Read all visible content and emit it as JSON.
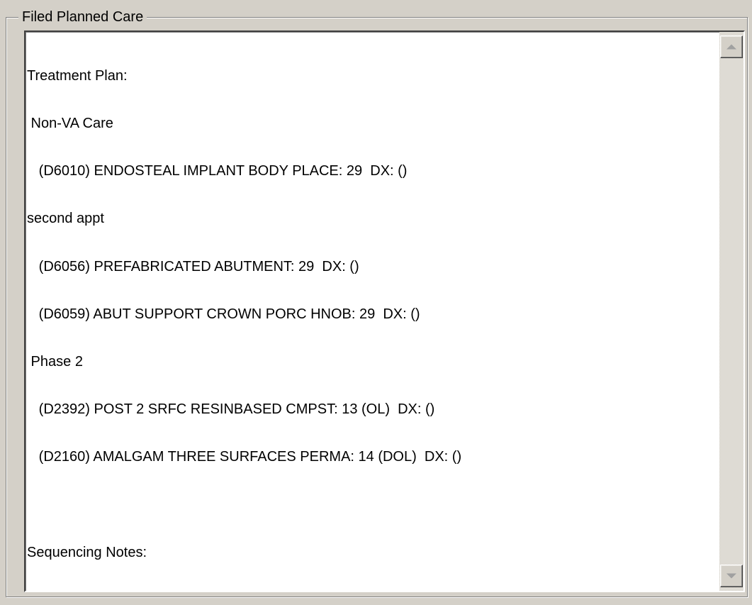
{
  "groupbox": {
    "title": "Filed Planned Care"
  },
  "memo": {
    "lines": [
      "Treatment Plan:",
      " Non-VA Care",
      "   (D6010) ENDOSTEAL IMPLANT BODY PLACE: 29  DX: ()",
      "second appt",
      "   (D6056) PREFABRICATED ABUTMENT: 29  DX: ()",
      "   (D6059) ABUT SUPPORT CROWN PORC HNOB: 29  DX: ()",
      " Phase 2",
      "   (D2392) POST 2 SRFC RESINBASED CMPST: 13 (OL)  DX: ()",
      "   (D2160) AMALGAM THREE SURFACES PERMA: 14 (DOL)  DX: ()",
      "",
      "Sequencing Notes:"
    ]
  },
  "scrollbar": {
    "up_icon": "arrow-up-icon",
    "down_icon": "arrow-down-icon"
  }
}
